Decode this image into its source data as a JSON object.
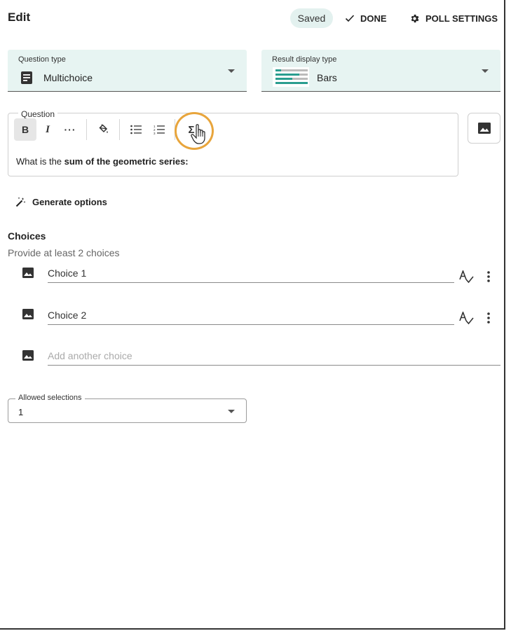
{
  "header": {
    "title": "Edit",
    "saved_label": "Saved",
    "done_label": "DONE",
    "poll_settings_label": "POLL SETTINGS"
  },
  "question_type": {
    "label": "Question type",
    "value": "Multichoice",
    "icon": "document-icon"
  },
  "result_display": {
    "label": "Result display type",
    "value": "Bars",
    "icon": "bars-thumbnail"
  },
  "question": {
    "label": "Question",
    "text_prefix": "What is the ",
    "text_bold": "sum of the geometric series:",
    "toolbar": [
      "bold",
      "italic",
      "more",
      "fill-color",
      "bulleted-list",
      "numbered-list",
      "equation"
    ],
    "active_tool": "bold",
    "hovered_tool": "equation"
  },
  "generate_options_label": "Generate options",
  "choices": {
    "heading": "Choices",
    "hint": "Provide at least 2 choices",
    "items": [
      {
        "label": "Choice 1"
      },
      {
        "label": "Choice 2"
      }
    ],
    "add_placeholder": "Add another choice"
  },
  "allowed_selections": {
    "label": "Allowed selections",
    "value": "1"
  },
  "colors": {
    "accent_teal": "#2a9d8f",
    "select_bg": "#e7f4f2",
    "highlight_ring": "#e8a53c"
  }
}
